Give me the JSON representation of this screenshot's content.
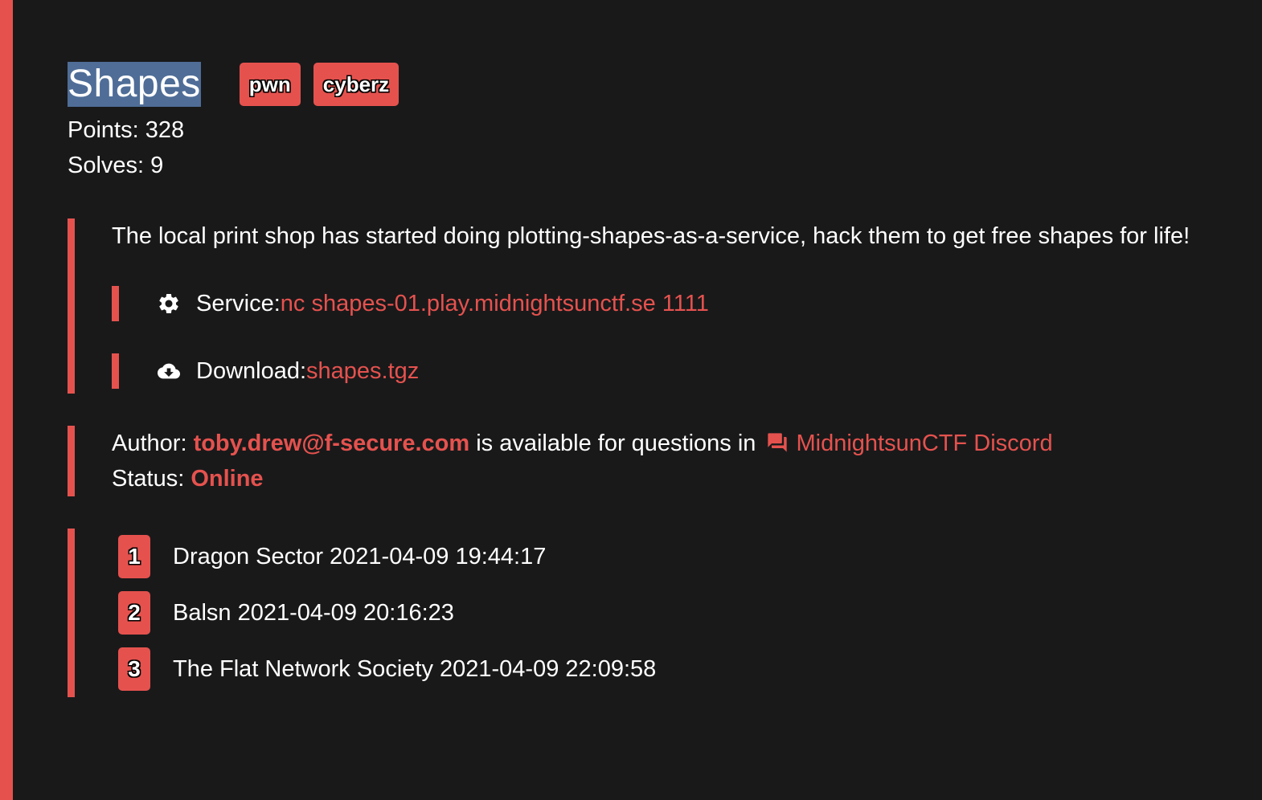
{
  "challenge": {
    "title": "Shapes",
    "tags": [
      "pwn",
      "cyberz"
    ],
    "points_label": "Points: 328",
    "solves_label": "Solves: 9",
    "description": "The local print shop has started doing plotting-shapes-as-a-service, hack them to get free shapes for life!"
  },
  "service": {
    "icon": "gear-icon",
    "label": "Service: ",
    "value": "nc shapes-01.play.midnightsunctf.se 1111"
  },
  "download": {
    "icon": "cloud-download-icon",
    "label": "Download: ",
    "file": "shapes.tgz"
  },
  "author": {
    "label": "Author: ",
    "email": "toby.drew@f-secure.com",
    "middle_text": " is available for questions in ",
    "discord_icon": "chat-icon",
    "discord_link": "MidnightsunCTF Discord",
    "status_label": "Status: ",
    "status_value": "Online"
  },
  "solves": [
    {
      "rank": "1",
      "text": "Dragon Sector 2021-04-09 19:44:17"
    },
    {
      "rank": "2",
      "text": "Balsn 2021-04-09 20:16:23"
    },
    {
      "rank": "3",
      "text": "The Flat Network Society 2021-04-09 22:09:58"
    }
  ],
  "colors": {
    "accent": "#e5524e",
    "background": "#19191a",
    "selection": "#4f6d97",
    "text": "#ffffff"
  }
}
